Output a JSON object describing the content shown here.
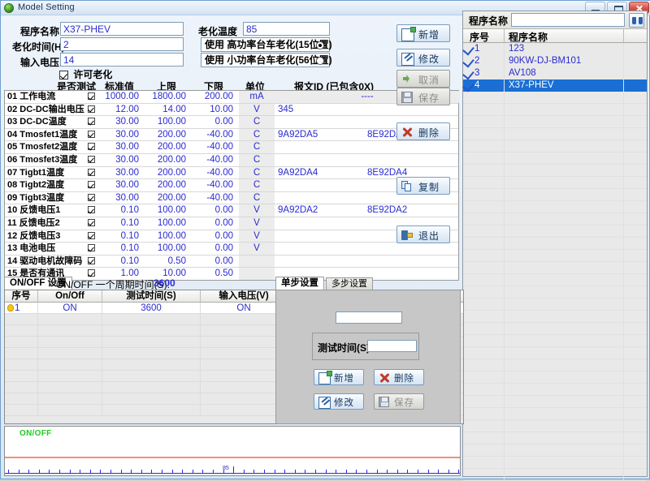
{
  "window": {
    "title": "Model Setting",
    "icon": "globe-icon",
    "buttons": {
      "minimize": "minimize-icon",
      "maximize": "maximize-icon",
      "close": "close-icon"
    }
  },
  "form": {
    "program_name_label": "程序名称",
    "program_name_value": "X37-PHEV",
    "aging_time_label": "老化时间(H)",
    "aging_time_value": "2",
    "input_voltage_label": "输入电压",
    "input_voltage_value": "14",
    "allow_aging_label": "许可老化",
    "allow_aging_checked": true,
    "aging_temp_label": "老化温度",
    "aging_temp_value": "85",
    "radio_high_label": "使用  高功率台车老化(15位置)",
    "radio_high_selected": true,
    "radio_low_label": "使用  小功率台车老化(56位置)",
    "radio_low_selected": false
  },
  "grid": {
    "headers": {
      "test": "是否测试",
      "standard": "标准值",
      "upper": "上限",
      "lower": "下限",
      "unit": "单位",
      "msgid": "报文ID (已包含0X)"
    },
    "rows": [
      {
        "no": "01",
        "name": "工作电流",
        "checked": true,
        "std": "1000.00",
        "up": "1800.00",
        "low": "200.00",
        "unit": "mA",
        "id1": "----",
        "id2": "",
        "dash": true
      },
      {
        "no": "02",
        "name": "DC-DC输出电压",
        "checked": true,
        "std": "12.00",
        "up": "14.00",
        "low": "10.00",
        "unit": "V",
        "id1": "345",
        "id2": "",
        "dash": false
      },
      {
        "no": "03",
        "name": "DC-DC温度",
        "checked": true,
        "std": "30.00",
        "up": "100.00",
        "low": "0.00",
        "unit": "C",
        "id1": "",
        "id2": "",
        "dash": false
      },
      {
        "no": "04",
        "name": "Tmosfet1温度",
        "checked": true,
        "std": "30.00",
        "up": "200.00",
        "low": "-40.00",
        "unit": "C",
        "id1": "9A92DA5",
        "id2": "8E92DA5",
        "dash": false
      },
      {
        "no": "05",
        "name": "Tmosfet2温度",
        "checked": true,
        "std": "30.00",
        "up": "200.00",
        "low": "-40.00",
        "unit": "C",
        "id1": "",
        "id2": "",
        "dash": false
      },
      {
        "no": "06",
        "name": "Tmosfet3温度",
        "checked": true,
        "std": "30.00",
        "up": "200.00",
        "low": "-40.00",
        "unit": "C",
        "id1": "",
        "id2": "",
        "dash": false
      },
      {
        "no": "07",
        "name": "Tigbt1温度",
        "checked": true,
        "std": "30.00",
        "up": "200.00",
        "low": "-40.00",
        "unit": "C",
        "id1": "9A92DA4",
        "id2": "8E92DA4",
        "dash": false
      },
      {
        "no": "08",
        "name": "Tigbt2温度",
        "checked": true,
        "std": "30.00",
        "up": "200.00",
        "low": "-40.00",
        "unit": "C",
        "id1": "",
        "id2": "",
        "dash": false
      },
      {
        "no": "09",
        "name": "Tigbt3温度",
        "checked": true,
        "std": "30.00",
        "up": "200.00",
        "low": "-40.00",
        "unit": "C",
        "id1": "",
        "id2": "",
        "dash": false
      },
      {
        "no": "10",
        "name": "反馈电压1",
        "checked": true,
        "std": "0.10",
        "up": "100.00",
        "low": "0.00",
        "unit": "V",
        "id1": "9A92DA2",
        "id2": "8E92DA2",
        "dash": false
      },
      {
        "no": "11",
        "name": "反馈电压2",
        "checked": true,
        "std": "0.10",
        "up": "100.00",
        "low": "0.00",
        "unit": "V",
        "id1": "",
        "id2": "",
        "dash": false
      },
      {
        "no": "12",
        "name": "反馈电压3",
        "checked": true,
        "std": "0.10",
        "up": "100.00",
        "low": "0.00",
        "unit": "V",
        "id1": "",
        "id2": "",
        "dash": false
      },
      {
        "no": "13",
        "name": "电池电压",
        "checked": true,
        "std": "0.10",
        "up": "100.00",
        "low": "0.00",
        "unit": "V",
        "id1": "",
        "id2": "",
        "dash": false
      },
      {
        "no": "14",
        "name": "驱动电机故障码",
        "checked": true,
        "std": "0.10",
        "up": "0.50",
        "low": "0.00",
        "unit": "",
        "id1": "",
        "id2": "",
        "dash": false
      },
      {
        "no": "15",
        "name": "是否有通讯",
        "checked": true,
        "std": "1.00",
        "up": "10.00",
        "low": "0.50",
        "unit": "",
        "id1": "",
        "id2": "",
        "dash": false
      }
    ]
  },
  "actions": {
    "add": {
      "label": "新增",
      "icon": "new-document-icon",
      "enabled": true
    },
    "modify": {
      "label": "修改",
      "icon": "edit-pencil-icon",
      "enabled": true
    },
    "cancel": {
      "label": "取消",
      "icon": "undo-arrow-icon",
      "enabled": false
    },
    "save": {
      "label": "保存",
      "icon": "floppy-disk-icon",
      "enabled": false
    },
    "delete": {
      "label": "删除",
      "icon": "red-x-icon",
      "enabled": true
    },
    "copy": {
      "label": "复制",
      "icon": "copy-pages-icon",
      "enabled": true
    },
    "exit": {
      "label": "退出",
      "icon": "exit-door-icon",
      "enabled": true
    }
  },
  "program_list": {
    "search_label": "程序名称",
    "search_value": "",
    "search_icon": "binoculars-icon",
    "col_no": "序号",
    "col_name": "程序名称",
    "rows": [
      {
        "no": "1",
        "name": "123",
        "checked": true,
        "selected": false
      },
      {
        "no": "2",
        "name": "90KW-DJ-BM101",
        "checked": true,
        "selected": false
      },
      {
        "no": "3",
        "name": "AV108",
        "checked": true,
        "selected": false
      },
      {
        "no": "4",
        "name": "X37-PHEV",
        "checked": true,
        "selected": true
      }
    ]
  },
  "onoff": {
    "tab_label": "ON/OFF 设置",
    "cycle_label": "ON/OFF 一个周期时间(S):",
    "cycle_value": "3600",
    "headers": {
      "no": "序号",
      "onoff": "On/Off",
      "test_time": "测试时间(S)",
      "input_voltage": "输入电压(V)"
    },
    "rows": [
      {
        "no": "1",
        "onoff": "ON",
        "test_time": "3600",
        "input_voltage": "ON",
        "icon": "bulb-icon"
      }
    ]
  },
  "steps": {
    "tabs": [
      {
        "label": "单步设置",
        "active": true
      },
      {
        "label": "多步设置",
        "active": false
      }
    ],
    "name_value": "",
    "test_time_label": "测试时间(S)",
    "test_time_value": "",
    "buttons": {
      "add": {
        "label": "新增",
        "icon": "new-document-icon",
        "enabled": true
      },
      "delete": {
        "label": "删除",
        "icon": "red-x-icon",
        "enabled": true
      },
      "modify": {
        "label": "修改",
        "icon": "edit-pencil-icon",
        "enabled": true
      },
      "save": {
        "label": "保存",
        "icon": "floppy-disk-icon",
        "enabled": false
      }
    }
  },
  "chart": {
    "series_label": "ON/OFF",
    "series_color": "#22cc22",
    "level_line_color": "#f58a7e",
    "axis_color": "#2a2ad0",
    "axis_mark": "85"
  }
}
